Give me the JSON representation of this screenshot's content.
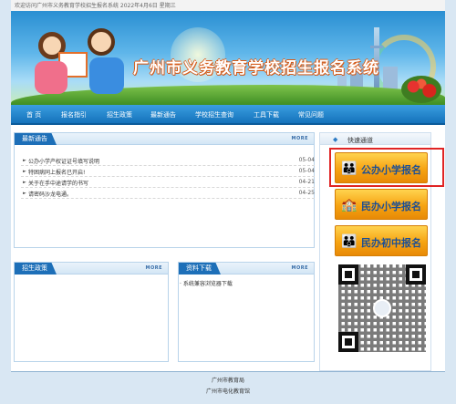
{
  "topbar": {
    "text": "欢迎访问广州市义务教育学校招生报名系统 2022年4月6日 星期三"
  },
  "banner": {
    "title": "广州市义务教育学校招生报名系统"
  },
  "nav": [
    "首 页",
    "报名指引",
    "招生政策",
    "最新通告",
    "学校招生查询",
    "工具下载",
    "常见问题"
  ],
  "news": {
    "title": "最新通告",
    "more": "MORE",
    "items": [
      {
        "text": "公办小学产权证证号填写说明",
        "date": "05-04"
      },
      {
        "text": "特困病同上报名已开启!",
        "date": "05-04"
      },
      {
        "text": "关于在手中途请学的书写",
        "date": "04-21"
      },
      {
        "text": "请密码沙龙电通。",
        "date": "04-25"
      }
    ]
  },
  "quick": {
    "title": "快速通道",
    "buttons": [
      {
        "label": "公办小学报名",
        "icon": "students-icon"
      },
      {
        "label": "民办小学报名",
        "icon": "school-icon"
      },
      {
        "label": "民办初中报名",
        "icon": "students-icon"
      }
    ]
  },
  "policy": {
    "title": "招生政策",
    "more": "MORE"
  },
  "downloads": {
    "title": "资料下载",
    "more": "MORE",
    "items": [
      "系统兼容浏览器下载"
    ]
  },
  "footer": {
    "line1": "广州市教育局",
    "line2": "广州市电化教育馆"
  },
  "colors": {
    "nav": "#1572bb",
    "tab": "#1d6fb8",
    "button": "#f6a312",
    "highlight": "#e02424"
  }
}
